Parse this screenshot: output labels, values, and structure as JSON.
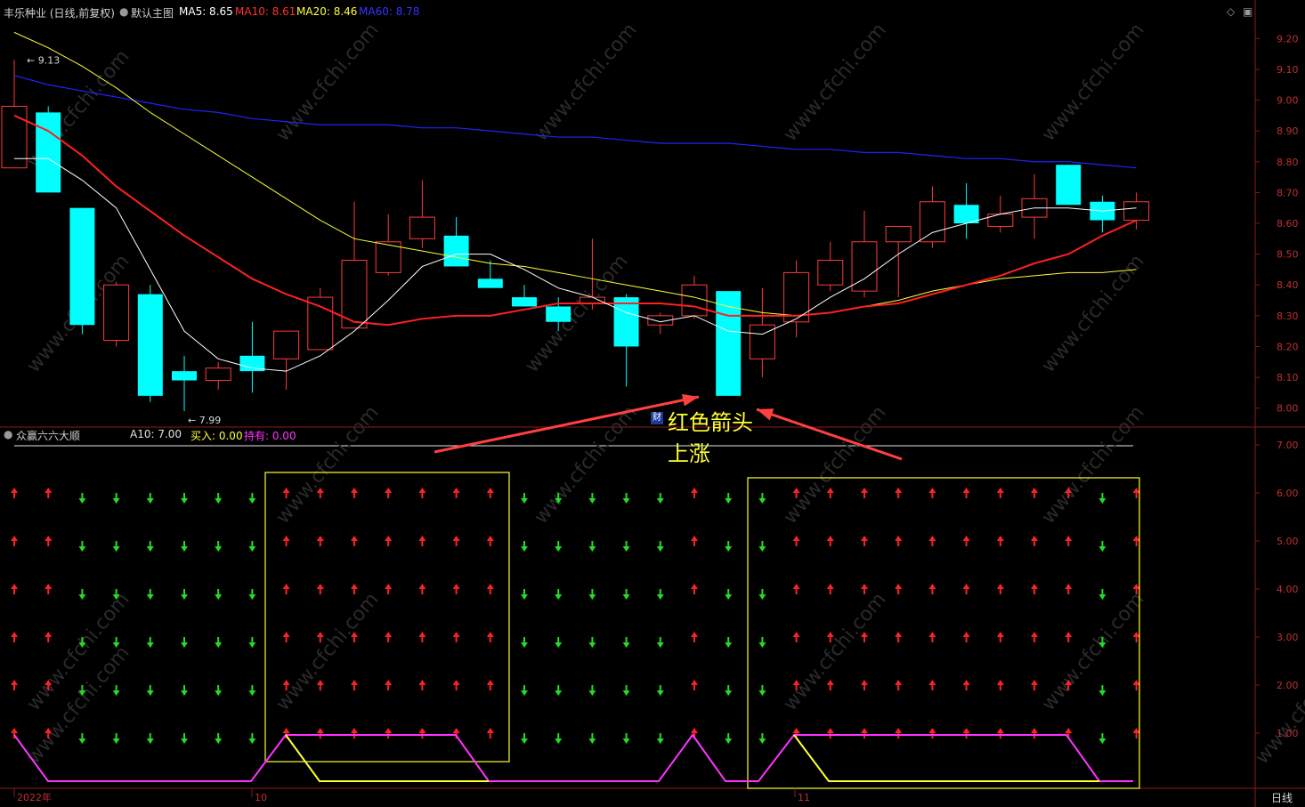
{
  "header": {
    "stock": "丰乐种业 (日线,前复权)",
    "main_label": "默认主图",
    "ma5": "MA5: 8.65",
    "ma10": "MA10: 8.61",
    "ma20": "MA20: 8.46",
    "ma60": "MA60: 8.78"
  },
  "sub_header": {
    "indicator": "众赢六六大顺",
    "a10": "A10: 7.00",
    "buy": "买入: 0.00",
    "hold": "持有: 0.00"
  },
  "price_axis": [
    "9.20",
    "9.10",
    "9.00",
    "8.90",
    "8.80",
    "8.70",
    "8.60",
    "8.50",
    "8.40",
    "8.30",
    "8.20",
    "8.10",
    "8.00"
  ],
  "sub_axis": [
    "7.00",
    "6.00",
    "5.00",
    "4.00",
    "3.00",
    "2.00",
    "1.00"
  ],
  "time_axis": [
    "2022年",
    "10",
    "11"
  ],
  "period_label": "日线",
  "markers": {
    "high": "9.13",
    "low": "7.99"
  },
  "annotation": {
    "line1": "红色箭头",
    "line2": "上涨",
    "badge": "财"
  },
  "watermark": "www.cfchi.com",
  "colors": {
    "up": "#ff3b3b",
    "down": "#00ffff",
    "ma5": "#ffffff",
    "ma10": "#ff2020",
    "ma20": "#ffff33",
    "ma60": "#2222ff",
    "buy": "#ffff33",
    "hold": "#ff33ff",
    "arrow_up": "#ff2020",
    "arrow_down": "#22dd22"
  },
  "chart_data": {
    "type": "candlestick",
    "ylim": [
      7.95,
      9.25
    ],
    "candles": [
      {
        "o": 8.78,
        "h": 9.13,
        "l": 8.78,
        "c": 8.98
      },
      {
        "o": 8.96,
        "h": 8.98,
        "l": 8.7,
        "c": 8.7
      },
      {
        "o": 8.65,
        "h": 8.65,
        "l": 8.24,
        "c": 8.27
      },
      {
        "o": 8.22,
        "h": 8.41,
        "l": 8.2,
        "c": 8.4
      },
      {
        "o": 8.37,
        "h": 8.4,
        "l": 8.02,
        "c": 8.04
      },
      {
        "o": 8.12,
        "h": 8.17,
        "l": 7.99,
        "c": 8.09
      },
      {
        "o": 8.09,
        "h": 8.15,
        "l": 8.06,
        "c": 8.13
      },
      {
        "o": 8.17,
        "h": 8.28,
        "l": 8.05,
        "c": 8.12
      },
      {
        "o": 8.16,
        "h": 8.25,
        "l": 8.06,
        "c": 8.25
      },
      {
        "o": 8.19,
        "h": 8.39,
        "l": 8.19,
        "c": 8.36
      },
      {
        "o": 8.26,
        "h": 8.67,
        "l": 8.26,
        "c": 8.48
      },
      {
        "o": 8.44,
        "h": 8.63,
        "l": 8.43,
        "c": 8.54
      },
      {
        "o": 8.55,
        "h": 8.74,
        "l": 8.52,
        "c": 8.62
      },
      {
        "o": 8.56,
        "h": 8.62,
        "l": 8.46,
        "c": 8.46
      },
      {
        "o": 8.42,
        "h": 8.48,
        "l": 8.39,
        "c": 8.39
      },
      {
        "o": 8.36,
        "h": 8.4,
        "l": 8.33,
        "c": 8.33
      },
      {
        "o": 8.33,
        "h": 8.36,
        "l": 8.25,
        "c": 8.28
      },
      {
        "o": 8.34,
        "h": 8.55,
        "l": 8.32,
        "c": 8.36
      },
      {
        "o": 8.36,
        "h": 8.37,
        "l": 8.07,
        "c": 8.2
      },
      {
        "o": 8.27,
        "h": 8.31,
        "l": 8.24,
        "c": 8.3
      },
      {
        "o": 8.3,
        "h": 8.43,
        "l": 8.29,
        "c": 8.4
      },
      {
        "o": 8.38,
        "h": 8.38,
        "l": 8.04,
        "c": 8.04
      },
      {
        "o": 8.16,
        "h": 8.39,
        "l": 8.1,
        "c": 8.27
      },
      {
        "o": 8.28,
        "h": 8.48,
        "l": 8.23,
        "c": 8.44
      },
      {
        "o": 8.4,
        "h": 8.54,
        "l": 8.38,
        "c": 8.48
      },
      {
        "o": 8.38,
        "h": 8.64,
        "l": 8.36,
        "c": 8.54
      },
      {
        "o": 8.54,
        "h": 8.59,
        "l": 8.36,
        "c": 8.59
      },
      {
        "o": 8.54,
        "h": 8.72,
        "l": 8.52,
        "c": 8.67
      },
      {
        "o": 8.66,
        "h": 8.73,
        "l": 8.55,
        "c": 8.6
      },
      {
        "o": 8.59,
        "h": 8.69,
        "l": 8.57,
        "c": 8.63
      },
      {
        "o": 8.62,
        "h": 8.76,
        "l": 8.55,
        "c": 8.68
      },
      {
        "o": 8.79,
        "h": 8.79,
        "l": 8.66,
        "c": 8.66
      },
      {
        "o": 8.67,
        "h": 8.69,
        "l": 8.57,
        "c": 8.61
      },
      {
        "o": 8.61,
        "h": 8.7,
        "l": 8.58,
        "c": 8.67
      }
    ],
    "ma5": [
      8.81,
      8.81,
      8.74,
      8.65,
      8.45,
      8.25,
      8.16,
      8.13,
      8.12,
      8.17,
      8.25,
      8.35,
      8.46,
      8.5,
      8.5,
      8.45,
      8.39,
      8.36,
      8.31,
      8.28,
      8.3,
      8.25,
      8.24,
      8.29,
      8.36,
      8.42,
      8.5,
      8.57,
      8.6,
      8.63,
      8.65,
      8.65,
      8.64,
      8.65
    ],
    "ma10": [
      8.95,
      8.9,
      8.82,
      8.72,
      8.64,
      8.56,
      8.49,
      8.42,
      8.37,
      8.33,
      8.28,
      8.27,
      8.29,
      8.3,
      8.3,
      8.32,
      8.34,
      8.34,
      8.34,
      8.34,
      8.33,
      8.3,
      8.3,
      8.3,
      8.31,
      8.33,
      8.34,
      8.37,
      8.4,
      8.43,
      8.47,
      8.5,
      8.56,
      8.61
    ],
    "ma20": [
      9.22,
      9.17,
      9.11,
      9.04,
      8.96,
      8.89,
      8.82,
      8.75,
      8.68,
      8.61,
      8.55,
      8.53,
      8.51,
      8.49,
      8.47,
      8.46,
      8.44,
      8.42,
      8.4,
      8.38,
      8.36,
      8.33,
      8.31,
      8.3,
      8.31,
      8.33,
      8.35,
      8.38,
      8.4,
      8.42,
      8.43,
      8.44,
      8.44,
      8.45
    ],
    "ma60": [
      9.08,
      9.05,
      9.03,
      9.01,
      8.99,
      8.97,
      8.96,
      8.94,
      8.93,
      8.92,
      8.92,
      8.92,
      8.91,
      8.91,
      8.9,
      8.89,
      8.88,
      8.88,
      8.87,
      8.86,
      8.86,
      8.86,
      8.85,
      8.84,
      8.84,
      8.83,
      8.83,
      8.82,
      8.81,
      8.81,
      8.8,
      8.8,
      8.79,
      8.78
    ],
    "signals": [
      "up",
      "up",
      "down",
      "down",
      "down",
      "down",
      "down",
      "down",
      "up",
      "up",
      "up",
      "up",
      "up",
      "up",
      "up",
      "down",
      "down",
      "down",
      "down",
      "down",
      "up",
      "down",
      "down",
      "up",
      "up",
      "up",
      "up",
      "up",
      "up",
      "up",
      "up",
      "up",
      "down",
      "up"
    ],
    "signal_top_rows": [
      "up",
      "up",
      "down",
      "down",
      "down",
      "down",
      "down",
      "down",
      "up",
      "up",
      "up",
      "up",
      "up",
      "up",
      "up",
      "down",
      "down",
      "down",
      "down",
      "down",
      "up",
      "down",
      "down",
      "up",
      "up",
      "up",
      "up",
      "up",
      "up",
      "up",
      "up",
      "up",
      "down",
      "up"
    ],
    "hold_line": [
      1,
      0,
      0,
      0,
      0,
      0,
      0,
      0,
      0,
      0,
      0,
      0,
      0,
      0,
      0,
      0,
      0,
      0,
      0,
      0,
      0,
      0,
      0,
      0,
      0,
      0,
      0,
      0,
      0,
      0,
      0,
      0,
      0,
      0
    ],
    "buy_line": [
      0,
      0,
      0,
      0,
      0,
      0,
      0,
      0,
      0,
      0,
      0,
      0,
      0,
      0,
      0,
      0,
      0,
      0,
      0,
      0,
      0,
      0,
      0,
      0,
      0,
      0,
      0,
      0,
      0,
      0,
      0,
      0,
      0,
      0
    ],
    "sub_ylim": [
      0,
      7.5
    ]
  }
}
